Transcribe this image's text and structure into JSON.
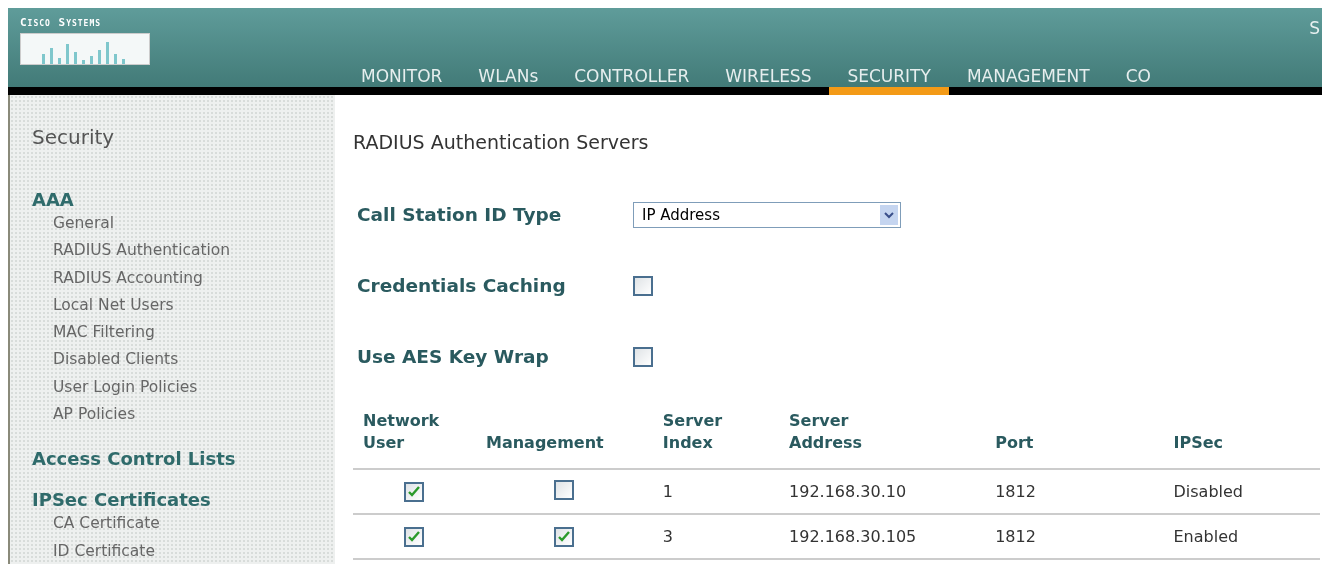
{
  "header": {
    "brand": "Cisco Systems",
    "top_right": "S",
    "nav": [
      {
        "label": "MONITOR",
        "selected": false
      },
      {
        "label": "WLANs",
        "selected": false
      },
      {
        "label": "CONTROLLER",
        "selected": false
      },
      {
        "label": "WIRELESS",
        "selected": false
      },
      {
        "label": "SECURITY",
        "selected": true
      },
      {
        "label": "MANAGEMENT",
        "selected": false
      },
      {
        "label": "CO",
        "selected": false
      }
    ]
  },
  "sidebar": {
    "title": "Security",
    "sections": [
      {
        "label": "AAA",
        "children": [
          {
            "label": "General"
          },
          {
            "label": "RADIUS Authentication"
          },
          {
            "label": "RADIUS Accounting"
          },
          {
            "label": "Local Net Users"
          },
          {
            "label": "MAC Filtering"
          },
          {
            "label": "Disabled Clients"
          },
          {
            "label": "User Login Policies"
          },
          {
            "label": "AP Policies"
          }
        ]
      },
      {
        "label": "Access Control Lists"
      },
      {
        "label": "IPSec Certificates",
        "children": [
          {
            "label": "CA Certificate"
          },
          {
            "label": "ID Certificate"
          }
        ]
      }
    ]
  },
  "content": {
    "title": "RADIUS Authentication Servers",
    "fields": [
      {
        "kind": "select",
        "label": "Call Station ID Type",
        "value": "IP Address"
      },
      {
        "kind": "checkbox",
        "label": "Credentials Caching",
        "checked": false
      },
      {
        "kind": "checkbox",
        "label": "Use AES Key Wrap",
        "checked": false
      }
    ],
    "table": {
      "columns": [
        "Network User",
        "Management",
        "Server Index",
        "Server Address",
        "Port",
        "IPSec"
      ],
      "rows": [
        {
          "network_user": true,
          "management": false,
          "index": "1",
          "address": "192.168.30.10",
          "port": "1812",
          "ipsec": "Disabled"
        },
        {
          "network_user": true,
          "management": true,
          "index": "3",
          "address": "192.168.30.105",
          "port": "1812",
          "ipsec": "Enabled"
        }
      ]
    }
  }
}
